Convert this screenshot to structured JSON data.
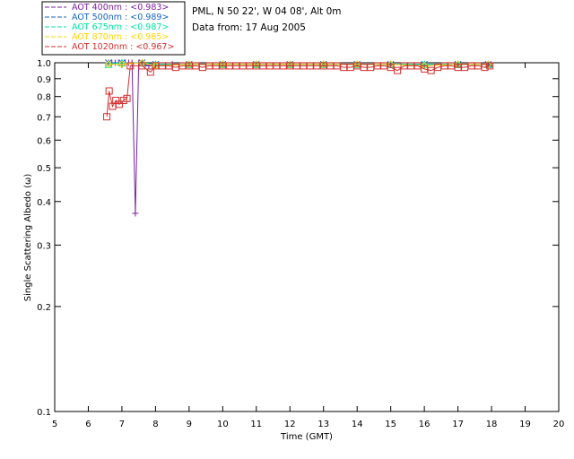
{
  "chart_data": {
    "type": "line",
    "yscale": "log",
    "xlabel": "Time (GMT)",
    "ylabel": "Single Scattering Albedo (ω)",
    "xlim": [
      5,
      20
    ],
    "ylim": [
      0.1,
      1.0
    ],
    "x_ticks": [
      "5",
      "6",
      "7",
      "8",
      "9",
      "10",
      "11",
      "12",
      "13",
      "14",
      "15",
      "16",
      "17",
      "18",
      "19",
      "20"
    ],
    "y_ticks": [
      {
        "v": 0.1,
        "label": "0.1"
      },
      {
        "v": 0.2,
        "label": "0.2"
      },
      {
        "v": 0.3,
        "label": "0.3"
      },
      {
        "v": 0.4,
        "label": "0.4"
      },
      {
        "v": 0.5,
        "label": "0.5"
      },
      {
        "v": 0.6,
        "label": "0.6"
      },
      {
        "v": 0.7,
        "label": "0.7"
      },
      {
        "v": 0.8,
        "label": "0.8"
      },
      {
        "v": 0.9,
        "label": "0.9"
      },
      {
        "v": 1.0,
        "label": "1.0"
      }
    ],
    "info": {
      "line1": "PML, N 50 22', W 04 08', Alt 0m",
      "line2": "Data from: 17 Aug 2005"
    },
    "series": [
      {
        "name": "AOT  400nm : <0.983>",
        "color": "#7b1fa2",
        "marker": "plus",
        "x": [
          6.6,
          6.7,
          6.8,
          6.9,
          7.0,
          7.1,
          7.2,
          7.3,
          7.4,
          7.5,
          7.6,
          7.8,
          8.0,
          8.5,
          9.0,
          10.0,
          11.0,
          12.0,
          13.0,
          14.0,
          15.0,
          16.0,
          17.0,
          17.9
        ],
        "values": [
          1.0,
          1.0,
          1.0,
          1.0,
          1.0,
          1.0,
          1.0,
          1.0,
          0.37,
          1.0,
          1.0,
          0.98,
          0.99,
          0.99,
          0.99,
          0.99,
          0.99,
          0.99,
          0.99,
          0.99,
          0.99,
          0.99,
          0.99,
          0.99
        ]
      },
      {
        "name": "AOT  500nm : <0.989>",
        "color": "#1565c0",
        "marker": "x",
        "x": [
          6.6,
          7.0,
          7.6,
          8.0,
          9.0,
          10.0,
          11.0,
          12.0,
          13.0,
          14.0,
          15.0,
          16.0,
          17.0,
          17.9
        ],
        "values": [
          1.0,
          1.0,
          1.0,
          0.99,
          0.99,
          0.99,
          0.99,
          0.99,
          0.99,
          0.99,
          0.99,
          0.99,
          0.99,
          0.99
        ]
      },
      {
        "name": "AOT  675nm : <0.987>",
        "color": "#00e5a0",
        "marker": "triangle",
        "x": [
          6.6,
          7.0,
          7.6,
          8.0,
          9.0,
          10.0,
          11.0,
          12.0,
          13.0,
          14.0,
          15.0,
          16.0,
          17.0,
          17.9
        ],
        "values": [
          0.99,
          1.0,
          1.0,
          0.99,
          0.99,
          0.99,
          0.99,
          0.99,
          0.99,
          0.99,
          0.99,
          0.99,
          0.99,
          0.99
        ]
      },
      {
        "name": "AOT  870nm : <0.985>",
        "color": "#ffd400",
        "marker": "diamond",
        "x": [
          6.6,
          7.0,
          7.6,
          8.0,
          9.0,
          10.0,
          11.0,
          12.0,
          13.0,
          14.0,
          15.0,
          16.0,
          17.0,
          17.9
        ],
        "values": [
          0.99,
          0.99,
          1.0,
          0.98,
          0.99,
          0.99,
          0.99,
          0.99,
          0.99,
          0.99,
          0.99,
          0.98,
          0.99,
          0.99
        ]
      },
      {
        "name": "AOT 1020nm : <0.967>",
        "color": "#d32f2f",
        "marker": "square",
        "x": [
          6.55,
          6.62,
          6.72,
          6.82,
          6.92,
          7.05,
          7.15,
          7.25,
          7.6,
          7.85,
          8.0,
          8.2,
          8.4,
          8.6,
          8.8,
          9.0,
          9.2,
          9.4,
          9.6,
          9.8,
          10.0,
          10.2,
          10.4,
          10.6,
          10.8,
          11.0,
          11.2,
          11.4,
          11.6,
          11.8,
          12.0,
          12.2,
          12.4,
          12.6,
          12.8,
          13.0,
          13.2,
          13.4,
          13.6,
          13.8,
          14.0,
          14.2,
          14.4,
          14.6,
          14.8,
          15.0,
          15.2,
          15.4,
          15.6,
          15.8,
          16.0,
          16.2,
          16.4,
          16.6,
          16.8,
          17.0,
          17.2,
          17.4,
          17.6,
          17.8,
          17.95
        ],
        "values": [
          0.7,
          0.83,
          0.75,
          0.78,
          0.76,
          0.78,
          0.79,
          0.98,
          0.98,
          0.94,
          0.98,
          0.98,
          0.98,
          0.97,
          0.98,
          0.98,
          0.98,
          0.97,
          0.98,
          0.98,
          0.98,
          0.98,
          0.98,
          0.98,
          0.98,
          0.98,
          0.98,
          0.98,
          0.98,
          0.98,
          0.98,
          0.98,
          0.98,
          0.98,
          0.98,
          0.98,
          0.98,
          0.98,
          0.97,
          0.97,
          0.98,
          0.97,
          0.97,
          0.98,
          0.98,
          0.97,
          0.95,
          0.98,
          0.98,
          0.98,
          0.96,
          0.95,
          0.97,
          0.98,
          0.98,
          0.97,
          0.97,
          0.98,
          0.98,
          0.97,
          0.98
        ]
      }
    ]
  }
}
